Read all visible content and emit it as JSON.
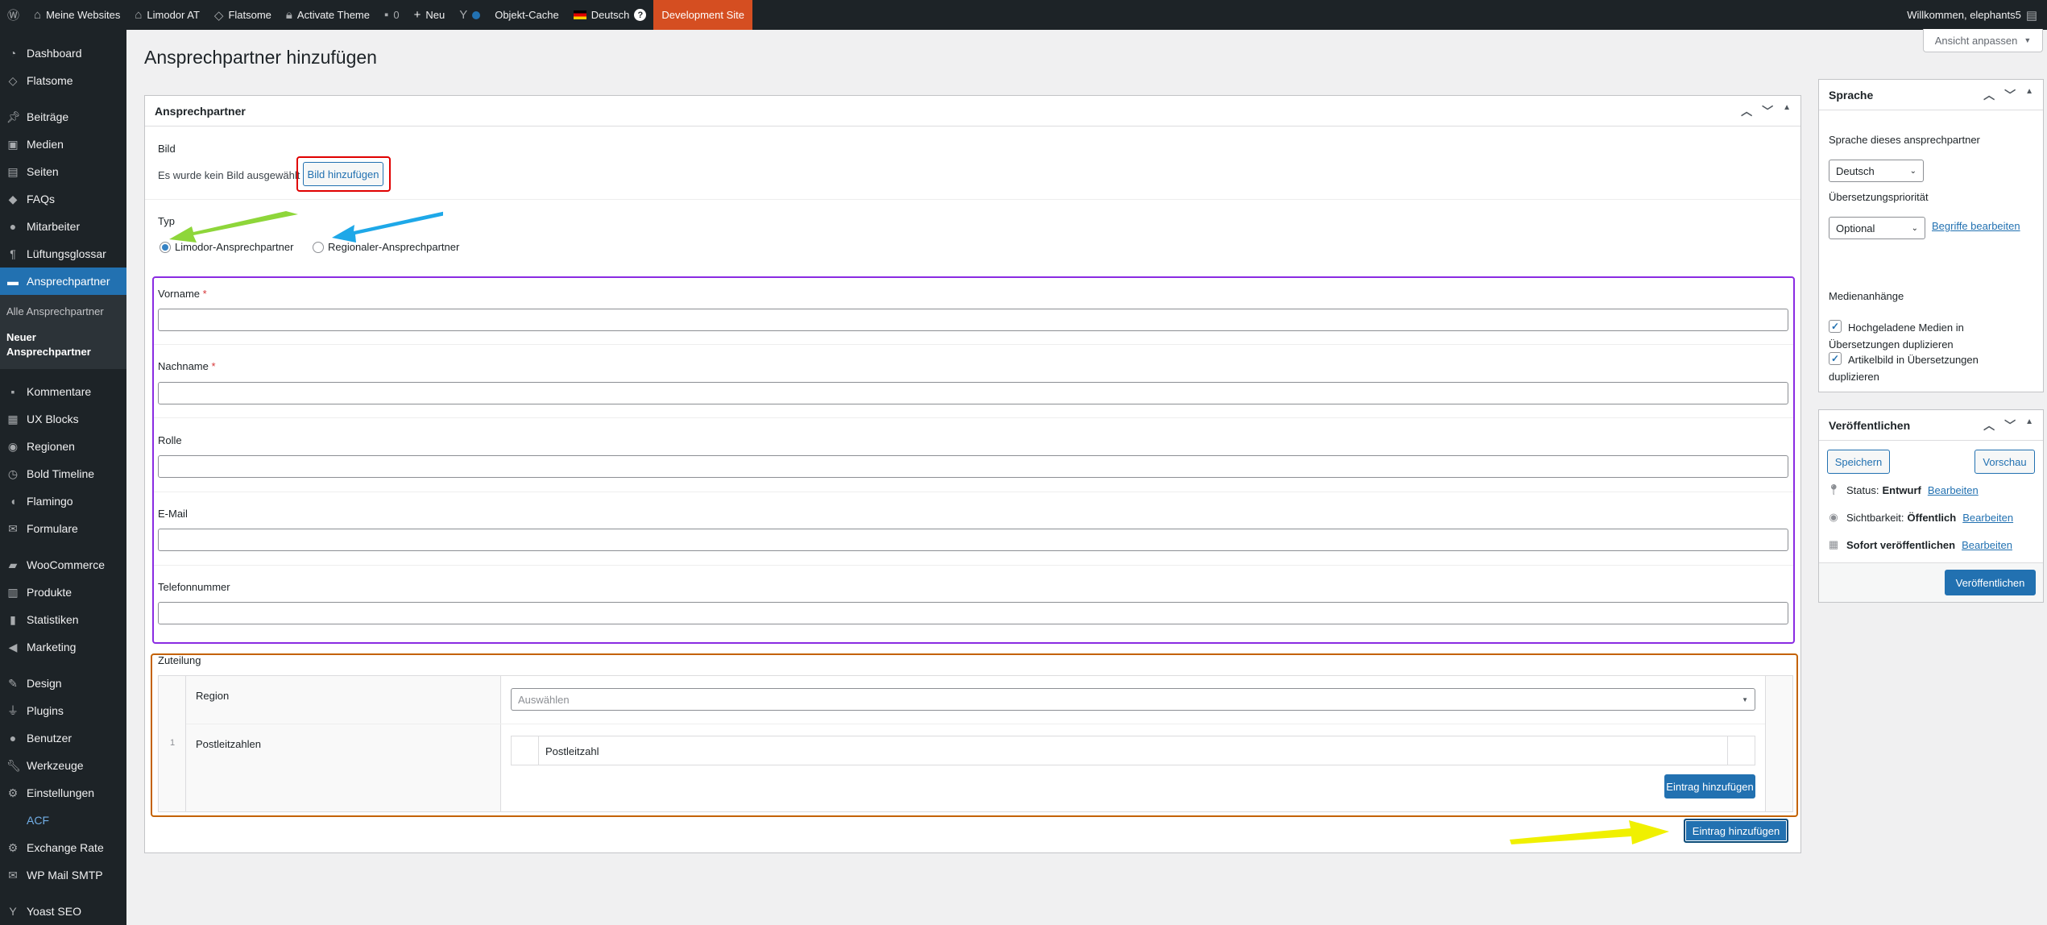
{
  "admin_bar": {
    "my_sites": "Meine Websites",
    "site": "Limodor AT",
    "flatsome": "Flatsome",
    "activate_theme": "Activate Theme",
    "comments_count": "0",
    "new": "Neu",
    "object_cache": "Objekt-Cache",
    "language": "Deutsch",
    "dev_site": "Development Site",
    "greeting": "Willkommen, elephants5"
  },
  "sidebar": {
    "items": [
      {
        "label": "Dashboard",
        "icon": "dashboard-icon"
      },
      {
        "label": "Flatsome",
        "icon": "flatsome-icon"
      },
      {
        "label": "Beiträge",
        "icon": "pin-icon"
      },
      {
        "label": "Medien",
        "icon": "media-icon"
      },
      {
        "label": "Seiten",
        "icon": "page-icon"
      },
      {
        "label": "FAQs",
        "icon": "faq-icon"
      },
      {
        "label": "Mitarbeiter",
        "icon": "person-icon"
      },
      {
        "label": "Lüftungsglossar",
        "icon": "paragraph-icon"
      },
      {
        "label": "Ansprechpartner",
        "icon": "id-card-icon"
      },
      {
        "label": "Kommentare",
        "icon": "comment-icon"
      },
      {
        "label": "UX Blocks",
        "icon": "grid-icon"
      },
      {
        "label": "Regionen",
        "icon": "location-icon"
      },
      {
        "label": "Bold Timeline",
        "icon": "clock-icon"
      },
      {
        "label": "Flamingo",
        "icon": "flamingo-icon"
      },
      {
        "label": "Formulare",
        "icon": "mail-icon"
      },
      {
        "label": "WooCommerce",
        "icon": "woocommerce-icon"
      },
      {
        "label": "Produkte",
        "icon": "archive-icon"
      },
      {
        "label": "Statistiken",
        "icon": "chart-bar-icon"
      },
      {
        "label": "Marketing",
        "icon": "megaphone-icon"
      },
      {
        "label": "Design",
        "icon": "brush-icon"
      },
      {
        "label": "Plugins",
        "icon": "plugin-icon"
      },
      {
        "label": "Benutzer",
        "icon": "users-icon"
      },
      {
        "label": "Werkzeuge",
        "icon": "wrench-icon"
      },
      {
        "label": "Einstellungen",
        "icon": "settings-icon"
      },
      {
        "label": "ACF",
        "icon": ""
      },
      {
        "label": "Exchange Rate",
        "icon": "gear-icon"
      },
      {
        "label": "WP Mail SMTP",
        "icon": "mail-icon"
      },
      {
        "label": "Yoast SEO",
        "icon": "yoast-icon"
      }
    ],
    "submenu": {
      "all": "Alle Ansprechpartner",
      "new": "Neuer Ansprechpartner"
    }
  },
  "page": {
    "title": "Ansprechpartner hinzufügen",
    "screen_options": "Ansicht anpassen"
  },
  "main_box": {
    "title": "Ansprechpartner",
    "image_label": "Bild",
    "no_image_text": "Es wurde kein Bild ausgewählt",
    "add_image_button": "Bild hinzufügen",
    "type_label": "Typ",
    "type_options": [
      "Limodor-Ansprechpartner",
      "Regionaler-Ansprechpartner"
    ],
    "type_selected": "Limodor-Ansprechpartner",
    "fields": {
      "firstname": "Vorname",
      "lastname": "Nachname",
      "role": "Rolle",
      "email": "E-Mail",
      "phone": "Telefonnummer",
      "required_mark": "*"
    },
    "assignment": {
      "label": "Zuteilung",
      "row_number": "1",
      "region_label": "Region",
      "region_placeholder": "Auswählen",
      "zip_label": "Postleitzahlen",
      "zip_column": "Postleitzahl",
      "add_inner_button": "Eintrag hinzufügen"
    },
    "add_entry_button": "Eintrag hinzufügen"
  },
  "language_box": {
    "title": "Sprache",
    "language_label": "Sprache dieses ansprechpartner",
    "language_value": "Deutsch",
    "priority_label": "Übersetzungspriorität",
    "priority_value": "Optional",
    "edit_terms_link": "Begriffe bearbeiten",
    "media_heading": "Medienanhänge",
    "checkbox1": "Hochgeladene Medien in Übersetzungen duplizieren",
    "checkbox2": "Artikelbild in Übersetzungen duplizieren"
  },
  "publish_box": {
    "title": "Veröffentlichen",
    "save": "Speichern",
    "preview": "Vorschau",
    "status_label": "Status:",
    "status_value": "Entwurf",
    "visibility_label": "Sichtbarkeit:",
    "visibility_value": "Öffentlich",
    "schedule_label": "Sofort veröffentlichen",
    "edit_link": "Bearbeiten",
    "publish_button": "Veröffentlichen"
  },
  "annotation_colors": {
    "image_outline": "#e00000",
    "fields_outline": "#8a2be2",
    "assignment_outline": "#c46200",
    "green_arrow": "#8ed63a",
    "blue_arrow": "#1ea8e8",
    "yellow_arrow": "#f0f000"
  }
}
